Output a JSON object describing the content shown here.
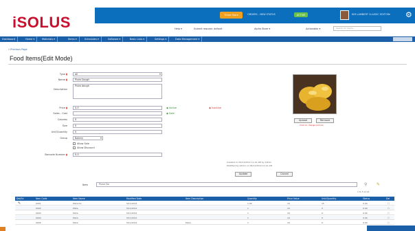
{
  "app": {
    "logo": "iSOLUS",
    "brand_color": "#c8102e",
    "accent_color": "#1b5fa8"
  },
  "topbar": {
    "orange_button": "Ticket Store",
    "status_text": "ORDERS - NEW STATUS",
    "green_badge": "ACTIVE",
    "user_name": "KIM LAMBERT CLASSIC EDITOR",
    "user_caret": "▾",
    "settings_icon": "gear-icon"
  },
  "subheader": {
    "items": [
      "Help ▾",
      "Submit request: default",
      "Alpha Store ▾",
      "Actionable ▾"
    ],
    "search_placeholder": "Search for Items..."
  },
  "nav": {
    "items": [
      "Dashboard",
      "Home ▾",
      "Materials ▾",
      "Items ▾",
      "Schedules ▾",
      "Software ▾",
      "Basic Lists ▾",
      "Settings ▾",
      "Data Management ▾"
    ]
  },
  "breadcrumb": "« Previous Page",
  "page_title": "Food Items(Edit Mode)",
  "form": {
    "type_label": "Type",
    "type_value": "All",
    "name_label": "Name",
    "name_value": "Pizza Dough",
    "desc_label": "Description",
    "desc_value": "Pizza dough",
    "price_label": "Price",
    "price_value": "0.0",
    "status_active": "Active",
    "status_inactive": "Inactive",
    "status_sale": "Sale",
    "cost_label": "Sales - Cost",
    "cost_value": "",
    "calories_label": "Calories",
    "calories_value": "0",
    "size_label": "Size",
    "size_value": "0",
    "unit_label": "Unit/Quantity",
    "unit_value": "0",
    "group_label": "Group",
    "group_value": "Bakery",
    "cb1": "Allow Sale",
    "cb2": "Allow Discount",
    "barcode_label": "Barcode Number",
    "barcode_value": "0.0"
  },
  "photo": {
    "upload_btn": "Upload",
    "remove_btn": "Remove",
    "note": "Click to change picture"
  },
  "form_note": {
    "line1": "Created on 05/11/2012 11:21 AM by Admin",
    "line2": "Modified by Admin on 05/11/2012 11:21 AM",
    "update_btn": "Update",
    "cancel_btn": "Cancel"
  },
  "list": {
    "search_label": "Item",
    "search_value": "Pizza Do",
    "headers": [
      "Del/Ed",
      "Item Code",
      "Item Name",
      "Modified Date",
      "Item Description",
      "Quantity",
      "Price Value",
      "Unit/Quantity",
      "Status",
      "Del"
    ],
    "rows": [
      [
        "",
        "0001",
        "Pizza Do",
        "5/11/2012",
        "",
        "1.00",
        "19",
        "15",
        "0.00"
      ],
      [
        "",
        "0002",
        "Pizza",
        "5/11/2012",
        "",
        "1",
        "19",
        "0",
        "0.00"
      ],
      [
        "",
        "0003",
        "Pizza",
        "5/11/2012",
        "",
        "1",
        "19",
        "0",
        "0.00"
      ],
      [
        "",
        "0004",
        "Pizza",
        "5/11/2012",
        "",
        "1",
        "19",
        "0",
        "0.00"
      ],
      [
        "",
        "0005",
        "Pizza",
        "5/11/2012",
        "Pizza",
        "1",
        "19",
        "0",
        "0.00"
      ]
    ]
  },
  "tools": {
    "excel_icon": "excel-icon",
    "pdf_icon": "pdf-icon",
    "page_info": "1 to 5 of 24"
  }
}
